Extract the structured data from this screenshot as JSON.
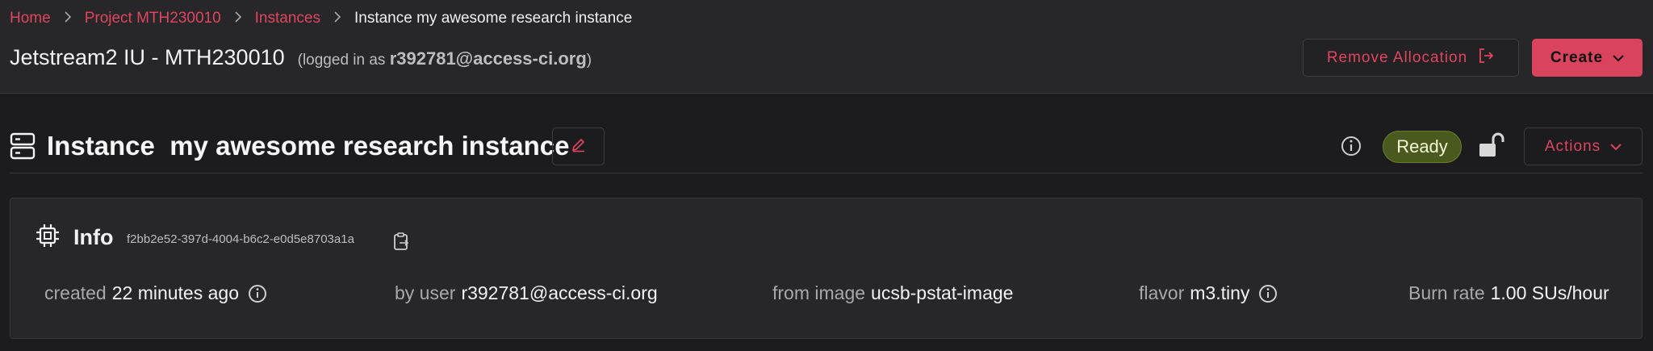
{
  "breadcrumb": {
    "home": "Home",
    "project": "Project MTH230010",
    "instances": "Instances",
    "current": "Instance my awesome research instance"
  },
  "header": {
    "project_name": "Jetstream2 IU - MTH230010",
    "login_prefix": "(logged in as ",
    "login_user": "r392781@access-ci.org",
    "login_suffix": ")",
    "remove_allocation_label": "Remove Allocation",
    "create_label": "Create"
  },
  "instance": {
    "title_prefix": "Instance",
    "title_name": "my awesome research instance",
    "status": "Ready",
    "actions_label": "Actions"
  },
  "info": {
    "label": "Info",
    "uuid": "f2bb2e52-397d-4004-b6c2-e0d5e8703a1a",
    "created_key": "created",
    "created_value": "22 minutes ago",
    "user_key": "by user",
    "user_value": "r392781@access-ci.org",
    "image_key": "from image",
    "image_value": "ucsb-pstat-image",
    "flavor_key": "flavor",
    "flavor_value": "m3.tiny",
    "burn_key": "Burn rate",
    "burn_value": "1.00 SUs/hour"
  },
  "colors": {
    "accent": "#e0455f",
    "create_bg": "#d9435d",
    "ready_bg": "#4a5a1e",
    "background": "#1c1c1e",
    "panel": "#27272a"
  },
  "icons": [
    "chevron-right-icon",
    "logout-icon",
    "chevron-down-icon",
    "server-icon",
    "pencil-icon",
    "info-icon",
    "unlock-icon",
    "cpu-chip-icon",
    "clipboard-copy-icon"
  ]
}
